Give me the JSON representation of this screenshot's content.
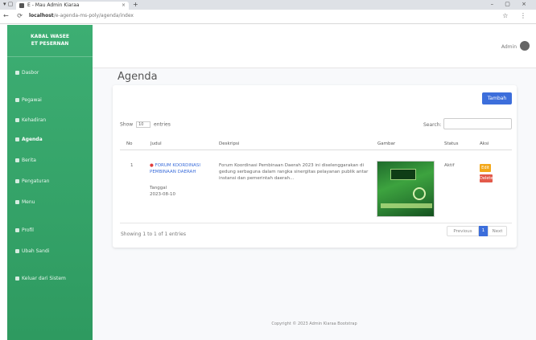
{
  "browser": {
    "tab_title": "E - Mau Admin Kiaraa",
    "tab_close": "×",
    "new_tab": "+",
    "url_host": "localhost",
    "url_path": "/e-agenda-ms-poly/agenda/index",
    "nav_icons": "← ⟳",
    "right_icons": "☆ ⋮",
    "window_controls": "– ▢ ×"
  },
  "sidebar": {
    "brand_line1": "KABAL WASEE",
    "brand_line2": "ET PESERNAN",
    "items": [
      {
        "label": "Dasbor"
      },
      {
        "label": "Pegawai"
      },
      {
        "label": "Kehadiran"
      },
      {
        "label": "Agenda"
      },
      {
        "label": "Berita"
      },
      {
        "label": "Pengaturan"
      },
      {
        "label": "Menu"
      },
      {
        "label": "Profil"
      },
      {
        "label": "Ubah Sandi"
      },
      {
        "label": "Keluar dari Sistem"
      }
    ]
  },
  "topbar": {
    "user": "Admin"
  },
  "page": {
    "title": "Agenda"
  },
  "card": {
    "add_button": "Tambah",
    "show_label": "Show",
    "show_value": "10",
    "entries_label": "entries",
    "search_label": "Search:",
    "columns": [
      "No",
      "Judul",
      "Deskripsi",
      "Gambar",
      "Status",
      "Aksi"
    ],
    "row": {
      "no": "1",
      "title": "FORUM KOORDINASI PEMBINAAN DAERAH",
      "date_label": "Tanggal",
      "date": "2023-08-10",
      "description": "Forum Koordinasi Pembinaan Daerah 2023 ini diselenggarakan di gedung serbaguna dalam rangka sinergitas pelayanan publik antar instansi dan pemerintah daerah...",
      "status": "Aktif",
      "status_sub": "",
      "edit": "Edit",
      "delete": "Delete"
    },
    "info": "Showing 1 to 1 of 1 entries",
    "prev": "Previous",
    "page": "1",
    "next": "Next"
  },
  "footer": {
    "text": "Copyright © 2023 Admin Kiaraa Bootstrap"
  },
  "colors": {
    "sidebar": "#3dae73",
    "primary": "#3c6edb",
    "warning": "#f3a81a",
    "danger": "#e35a4b"
  }
}
